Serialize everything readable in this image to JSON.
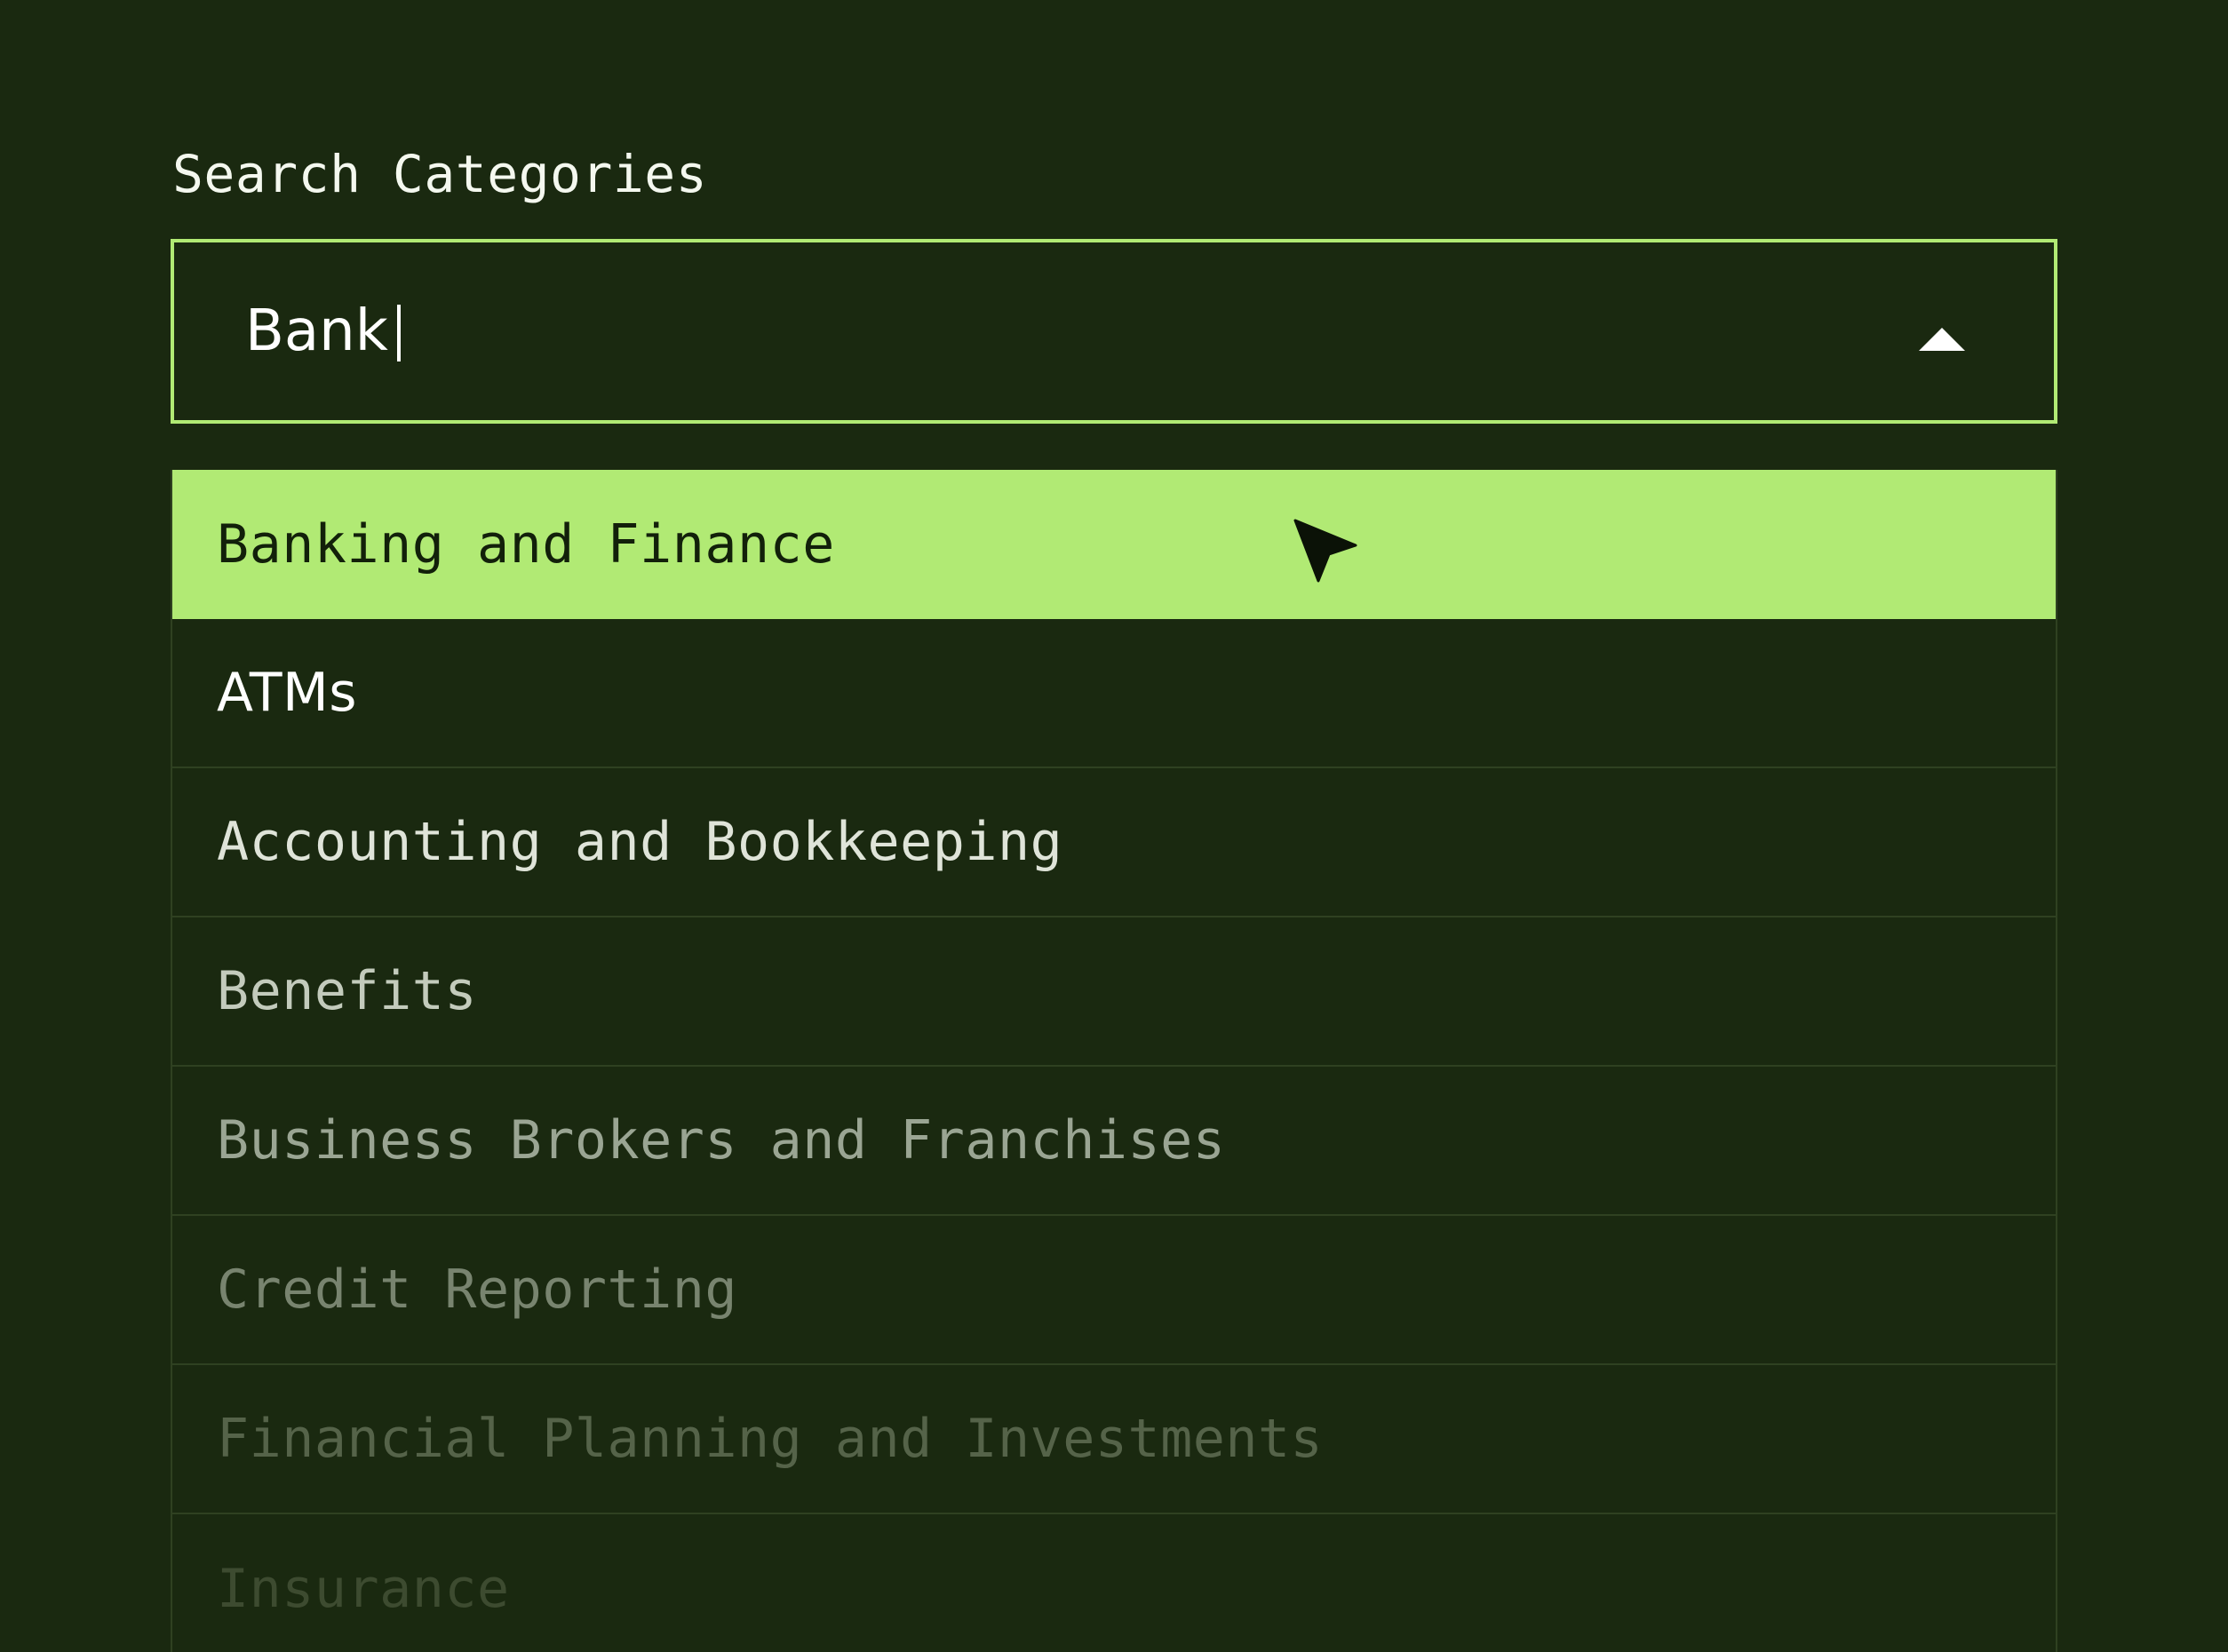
{
  "search": {
    "label": "Search Categories",
    "value": "Bank",
    "toggle_icon": "caret-up-icon"
  },
  "options": [
    {
      "label": "Banking and Finance",
      "state": "highlighted"
    },
    {
      "label": "ATMs"
    },
    {
      "label": "Accounting and Bookkeeping"
    },
    {
      "label": "Benefits"
    },
    {
      "label": "Business Brokers and Franchises"
    },
    {
      "label": "Credit Reporting"
    },
    {
      "label": "Financial Planning and Investments"
    },
    {
      "label": "Insurance"
    }
  ],
  "cursor": {
    "icon": "mouse-pointer-icon"
  },
  "colors": {
    "background": "#1a2910",
    "accent": "#b1ea74",
    "highlight_text": "#12200a",
    "text": "#ffffff",
    "divider": "#2f4121"
  }
}
